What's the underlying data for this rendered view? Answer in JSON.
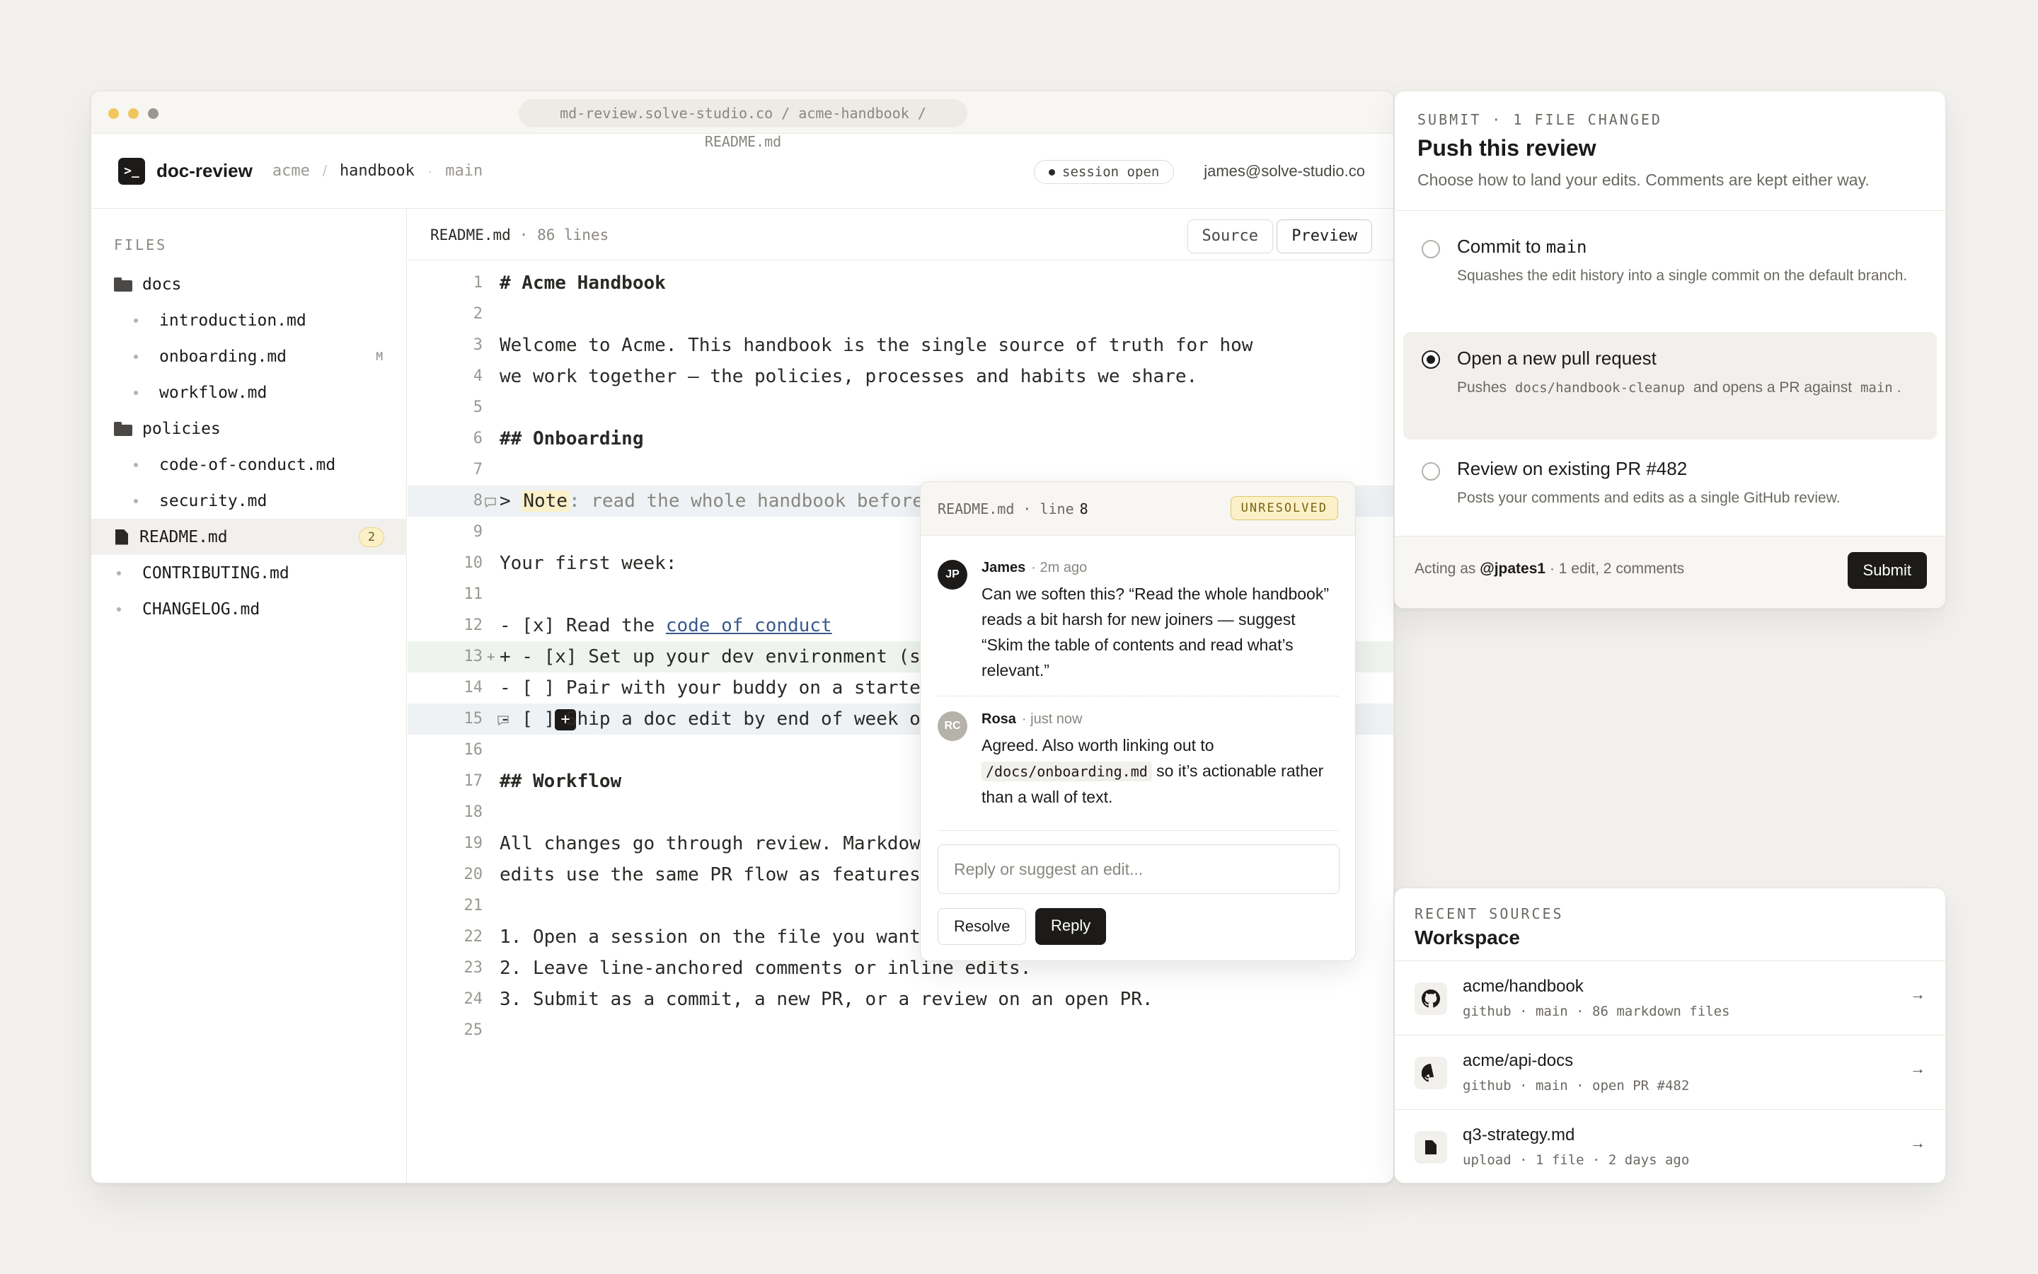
{
  "window": {
    "url": "md-review.solve-studio.co / acme-handbook / README.md",
    "dot_colors": [
      "#f0c75e",
      "#f0c75e",
      "#9a978f"
    ]
  },
  "topbar": {
    "logo_glyph": ">_",
    "app_name": "doc-review",
    "crumbs": [
      "acme",
      "/",
      "handbook",
      "·",
      "main"
    ],
    "session": "session open",
    "user_email": "james@solve-studio.co"
  },
  "sidebar": {
    "heading": "FILES",
    "items": [
      {
        "label": "docs",
        "kind": "folder"
      },
      {
        "label": "introduction.md",
        "kind": "file"
      },
      {
        "label": "onboarding.md",
        "kind": "file",
        "badge": "M"
      },
      {
        "label": "workflow.md",
        "kind": "file"
      },
      {
        "label": "policies",
        "kind": "folder"
      },
      {
        "label": "code-of-conduct.md",
        "kind": "file"
      },
      {
        "label": "security.md",
        "kind": "file"
      },
      {
        "label": "README.md",
        "kind": "doc",
        "badge": "2",
        "selected": true
      },
      {
        "label": "CONTRIBUTING.md",
        "kind": "root"
      },
      {
        "label": "CHANGELOG.md",
        "kind": "root"
      }
    ]
  },
  "editor": {
    "filename": "README.md",
    "meta": "· 86 lines",
    "source_label": "Source",
    "preview_label": "Preview",
    "lines": [
      {
        "n": "1",
        "t": "# Acme Handbook"
      },
      {
        "n": "2",
        "t": ""
      },
      {
        "n": "3",
        "t": "Welcome to Acme. This handbook is the single source of truth for how"
      },
      {
        "n": "4",
        "t": "we work together — the policies, processes and habits we share."
      },
      {
        "n": "5",
        "t": ""
      },
      {
        "n": "6",
        "t": "## Onboarding"
      },
      {
        "n": "7",
        "t": ""
      },
      {
        "n": "8",
        "t": ": read the whole handbook before"
      },
      {
        "n": "9",
        "t": ""
      },
      {
        "n": "10",
        "t": "Your first week:"
      },
      {
        "n": "11",
        "t": ""
      },
      {
        "n": "12",
        "t": "- [x] Read the "
      },
      {
        "n": "13",
        "t": "+ - [x] Set up your dev environment (se"
      },
      {
        "n": "14",
        "t": "- [ ] Pair with your buddy on a starte"
      },
      {
        "n": "15",
        "t": "- [ ] Ship a doc edit by end of week or"
      },
      {
        "n": "16",
        "t": ""
      },
      {
        "n": "17",
        "t": "## Workflow"
      },
      {
        "n": "18",
        "t": ""
      },
      {
        "n": "19",
        "t": "All changes go through review. Markdown"
      },
      {
        "n": "20",
        "t": "edits use the same PR flow as features"
      },
      {
        "n": "21",
        "t": ""
      },
      {
        "n": "22",
        "t": "1. Open a session on the file you want"
      },
      {
        "n": "23",
        "t": "2. Leave line-anchored comments or inline edits."
      },
      {
        "n": "24",
        "t": "3. Submit as a commit, a new PR, or a review on an open PR."
      },
      {
        "n": "25",
        "t": ""
      }
    ],
    "line8_prefix": "> ",
    "line8_note": "Note",
    "line12_link": "code of conduct",
    "gutter_plus": "+",
    "add_button": "+"
  },
  "comment_popup": {
    "file": "README.md",
    "line_label": "· line",
    "line_number": "8",
    "status": "UNRESOLVED",
    "comments": [
      {
        "initials": "JP",
        "name": "James",
        "time": "· 2m ago",
        "text": "Can we soften this? “Read the whole handbook” reads a bit harsh for new joiners — suggest “Skim the table of contents and read what’s relevant.”",
        "avatar_color": "#1c1b19"
      },
      {
        "initials": "RC",
        "name": "Rosa",
        "time": "· just now",
        "text_before": "Agreed. Also worth linking out to",
        "code": "/docs/onboarding.md",
        "text_after": "so it’s actionable rather than a wall of text.",
        "avatar_color": "#b5b2aa"
      }
    ],
    "reply_placeholder": "Reply or suggest an edit...",
    "resolve_label": "Resolve",
    "reply_label": "Reply"
  },
  "submit_panel": {
    "tag": "SUBMIT · 1 FILE CHANGED",
    "title": "Push this review",
    "subtitle": "Choose how to land your edits. Comments are kept either way.",
    "options": [
      {
        "title": "Commit to",
        "title_code": "main",
        "desc": "Squashes the edit history into a single commit on the default branch.",
        "selected": false
      },
      {
        "title": "Open a new pull request",
        "desc_before": "Pushes",
        "desc_code": "docs/handbook-cleanup",
        "desc_mid": "and opens a PR against",
        "desc_code2": "main",
        "desc_after": ".",
        "selected": true
      },
      {
        "title": "Review on existing PR #482",
        "desc": "Posts your comments and edits as a single GitHub review.",
        "selected": false
      }
    ],
    "acting_as_label": "Acting as",
    "acting_user": "@jpates1",
    "acting_summary": "· 1 edit, 2 comments",
    "submit_label": "Submit"
  },
  "sources_panel": {
    "tag": "RECENT SOURCES",
    "title": "Workspace",
    "items": [
      {
        "name": "acme/handbook",
        "meta": "github · main · 86 markdown files",
        "icon": "github-icon",
        "arrow": "→"
      },
      {
        "name": "acme/api-docs",
        "meta": "github · main · open PR #482",
        "icon": "github-icon",
        "arrow": "→"
      },
      {
        "name": "q3-strategy.md",
        "meta": "upload · 1 file · 2 days ago",
        "icon": "file-icon",
        "arrow": "→"
      }
    ]
  }
}
